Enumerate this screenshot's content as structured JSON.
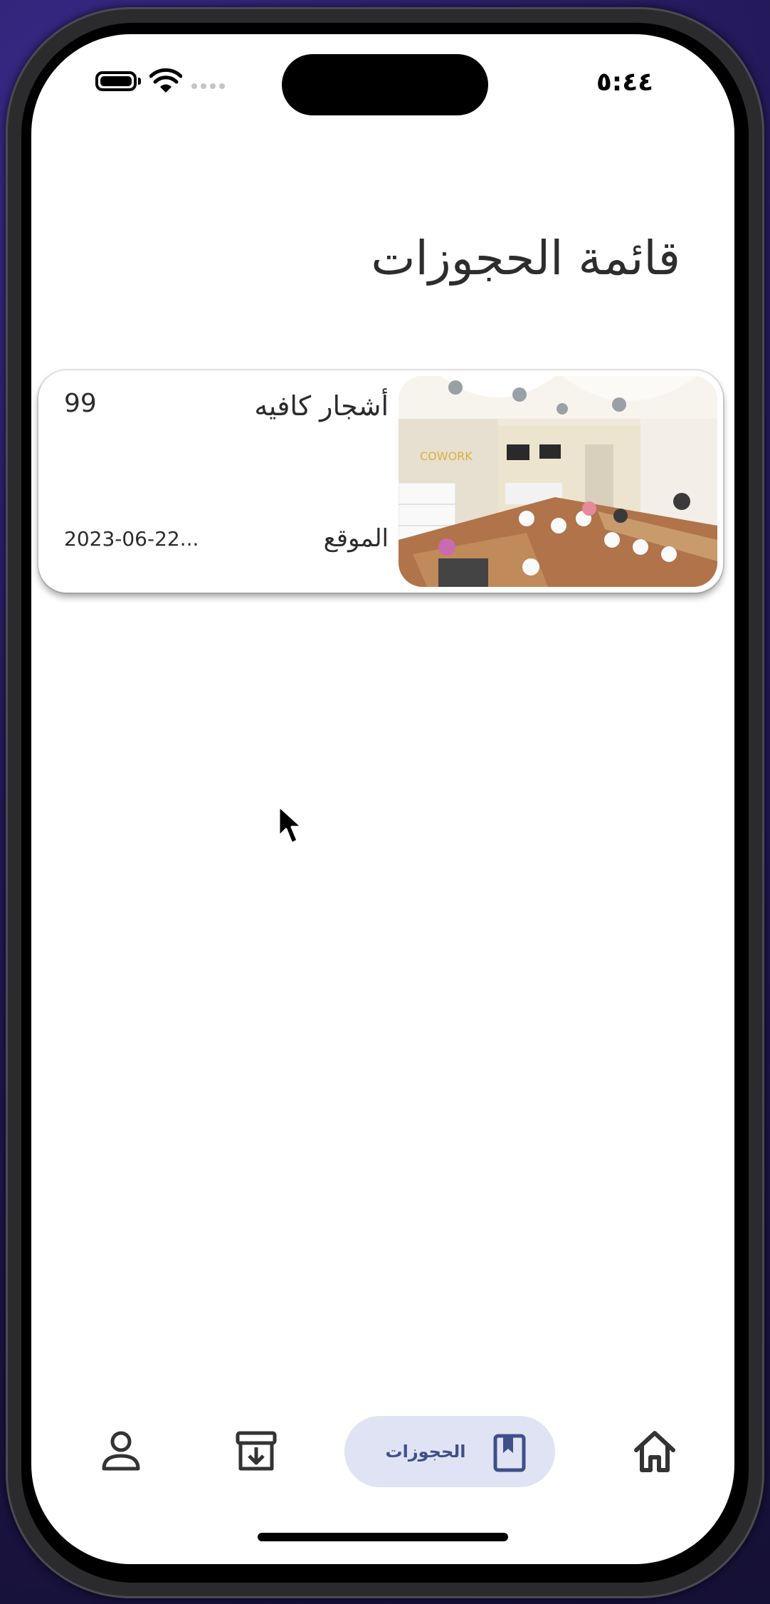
{
  "status": {
    "time": "٥:٤٤"
  },
  "page": {
    "title": "قائمة الحجوزات"
  },
  "booking": {
    "name": "أشجار كافيه",
    "price": "99",
    "location_label": "الموقع",
    "date": "2023-06-22..."
  },
  "nav": {
    "home_icon": "home-icon",
    "bookings_label": "الحجوزات",
    "bookings_icon": "bookmark-icon",
    "archive_icon": "archive-download-icon",
    "profile_icon": "person-icon",
    "active_color": "#dfe3f3",
    "active_text_color": "#3f4f8a"
  }
}
